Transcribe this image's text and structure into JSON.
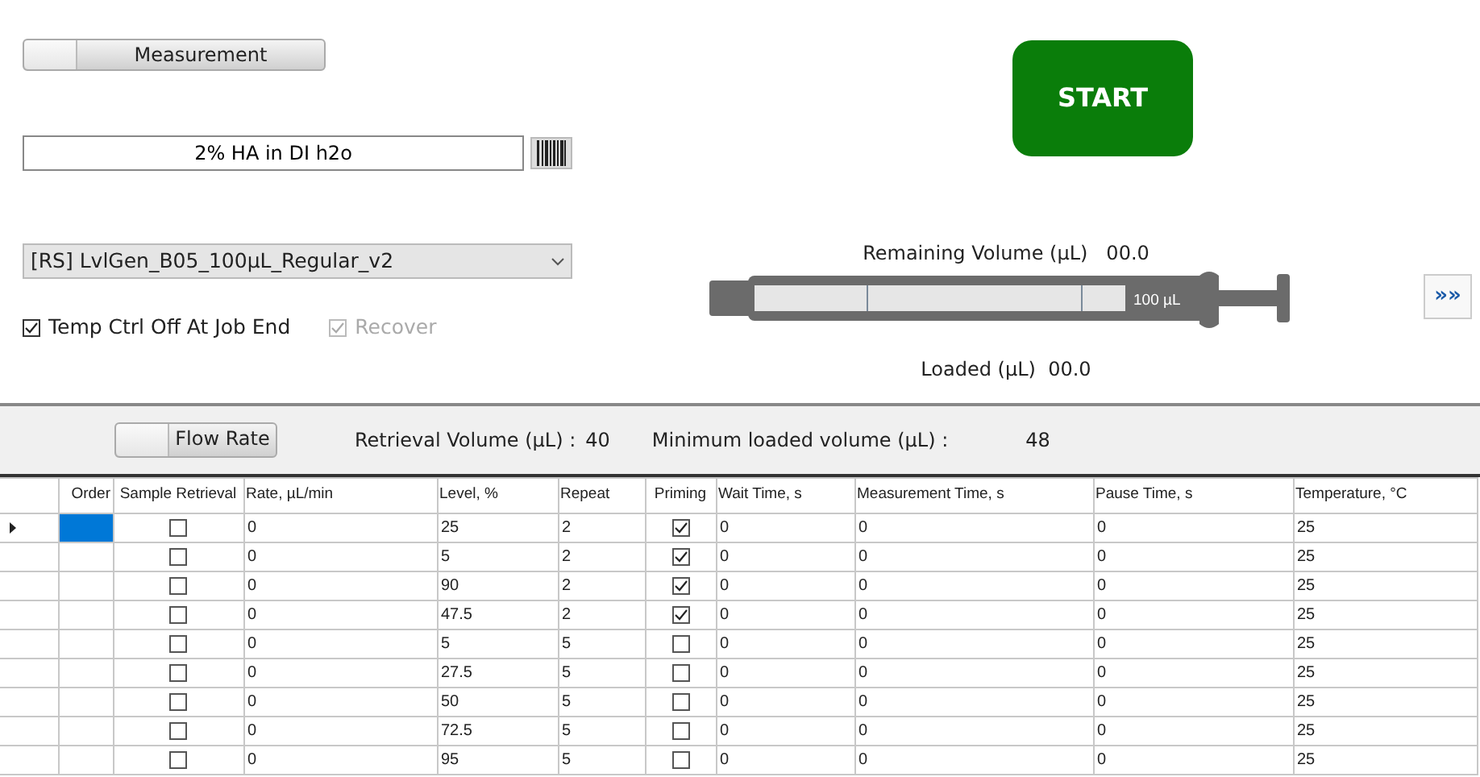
{
  "mode_toggle": {
    "label": "Measurement",
    "on": false
  },
  "sample_name": {
    "value": "2% HA in DI h2o"
  },
  "method_select": {
    "value": "[RS] LvlGen_B05_100µL_Regular_v2"
  },
  "options": [
    {
      "label": "Temp Ctrl Off At Job End",
      "checked": true,
      "disabled": false
    },
    {
      "label": "Recover",
      "checked": true,
      "disabled": true
    }
  ],
  "start_button": {
    "label": "START"
  },
  "syringe": {
    "remaining_label": "Remaining Volume (µL)",
    "remaining_value": "00.0",
    "capacity": "100 µL",
    "loaded_label": "Loaded (µL)",
    "loaded_value": "00.0"
  },
  "expand_button": {
    "label": "»»"
  },
  "settings_bar": {
    "toggle": {
      "label": "Flow Rate",
      "on": false
    },
    "retrieval_label": "Retrieval Volume (µL) :",
    "retrieval_value": "40",
    "min_loaded_label": "Minimum loaded volume (µL) :",
    "min_loaded_value": "48"
  },
  "table": {
    "columns": [
      "Order",
      "Sample Retrieval",
      "Rate, µL/min",
      "Level, %",
      "Repeat",
      "Priming",
      "Wait Time, s",
      "Measurement Time, s",
      "Pause Time, s",
      "Temperature, °C"
    ],
    "rows": [
      {
        "selected": true,
        "order": "",
        "sample_retrieval": false,
        "rate": "0",
        "level_pct": "25",
        "repeat": "2",
        "priming": true,
        "wait": "0",
        "measurement_time": "0",
        "pause": "0",
        "temperature": "25"
      },
      {
        "selected": false,
        "order": "",
        "sample_retrieval": false,
        "rate": "0",
        "level_pct": "5",
        "repeat": "2",
        "priming": true,
        "wait": "0",
        "measurement_time": "0",
        "pause": "0",
        "temperature": "25"
      },
      {
        "selected": false,
        "order": "",
        "sample_retrieval": false,
        "rate": "0",
        "level_pct": "90",
        "repeat": "2",
        "priming": true,
        "wait": "0",
        "measurement_time": "0",
        "pause": "0",
        "temperature": "25"
      },
      {
        "selected": false,
        "order": "",
        "sample_retrieval": false,
        "rate": "0",
        "level_pct": "47.5",
        "repeat": "2",
        "priming": true,
        "wait": "0",
        "measurement_time": "0",
        "pause": "0",
        "temperature": "25"
      },
      {
        "selected": false,
        "order": "",
        "sample_retrieval": false,
        "rate": "0",
        "level_pct": "5",
        "repeat": "5",
        "priming": false,
        "wait": "0",
        "measurement_time": "0",
        "pause": "0",
        "temperature": "25"
      },
      {
        "selected": false,
        "order": "",
        "sample_retrieval": false,
        "rate": "0",
        "level_pct": "27.5",
        "repeat": "5",
        "priming": false,
        "wait": "0",
        "measurement_time": "0",
        "pause": "0",
        "temperature": "25"
      },
      {
        "selected": false,
        "order": "",
        "sample_retrieval": false,
        "rate": "0",
        "level_pct": "50",
        "repeat": "5",
        "priming": false,
        "wait": "0",
        "measurement_time": "0",
        "pause": "0",
        "temperature": "25"
      },
      {
        "selected": false,
        "order": "",
        "sample_retrieval": false,
        "rate": "0",
        "level_pct": "72.5",
        "repeat": "5",
        "priming": false,
        "wait": "0",
        "measurement_time": "0",
        "pause": "0",
        "temperature": "25"
      },
      {
        "selected": false,
        "order": "",
        "sample_retrieval": false,
        "rate": "0",
        "level_pct": "95",
        "repeat": "5",
        "priming": false,
        "wait": "0",
        "measurement_time": "0",
        "pause": "0",
        "temperature": "25"
      }
    ]
  }
}
